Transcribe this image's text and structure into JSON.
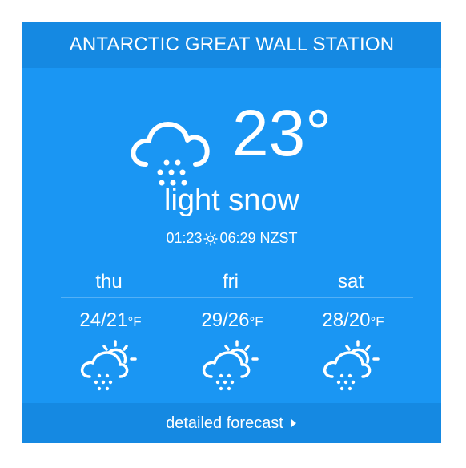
{
  "header": {
    "title": "ANTARCTIC GREAT WALL STATION"
  },
  "current": {
    "temperature": "23°",
    "condition": "light snow",
    "icon": "cloud-snow-icon",
    "sunrise": "01:23",
    "sunset": "06:29",
    "timezone": "NZST",
    "sun_icon": "sun-icon"
  },
  "forecast": [
    {
      "day": "thu",
      "temp": "24/21",
      "unit": "°F",
      "icon": "partly-sunny-snow-icon"
    },
    {
      "day": "fri",
      "temp": "29/26",
      "unit": "°F",
      "icon": "partly-sunny-snow-icon"
    },
    {
      "day": "sat",
      "temp": "28/20",
      "unit": "°F",
      "icon": "partly-sunny-snow-icon"
    }
  ],
  "footer": {
    "label": "detailed forecast",
    "icon": "caret-right-icon"
  },
  "colors": {
    "background": "#1a96f3",
    "bar": "#1589e2",
    "text": "#ffffff"
  }
}
